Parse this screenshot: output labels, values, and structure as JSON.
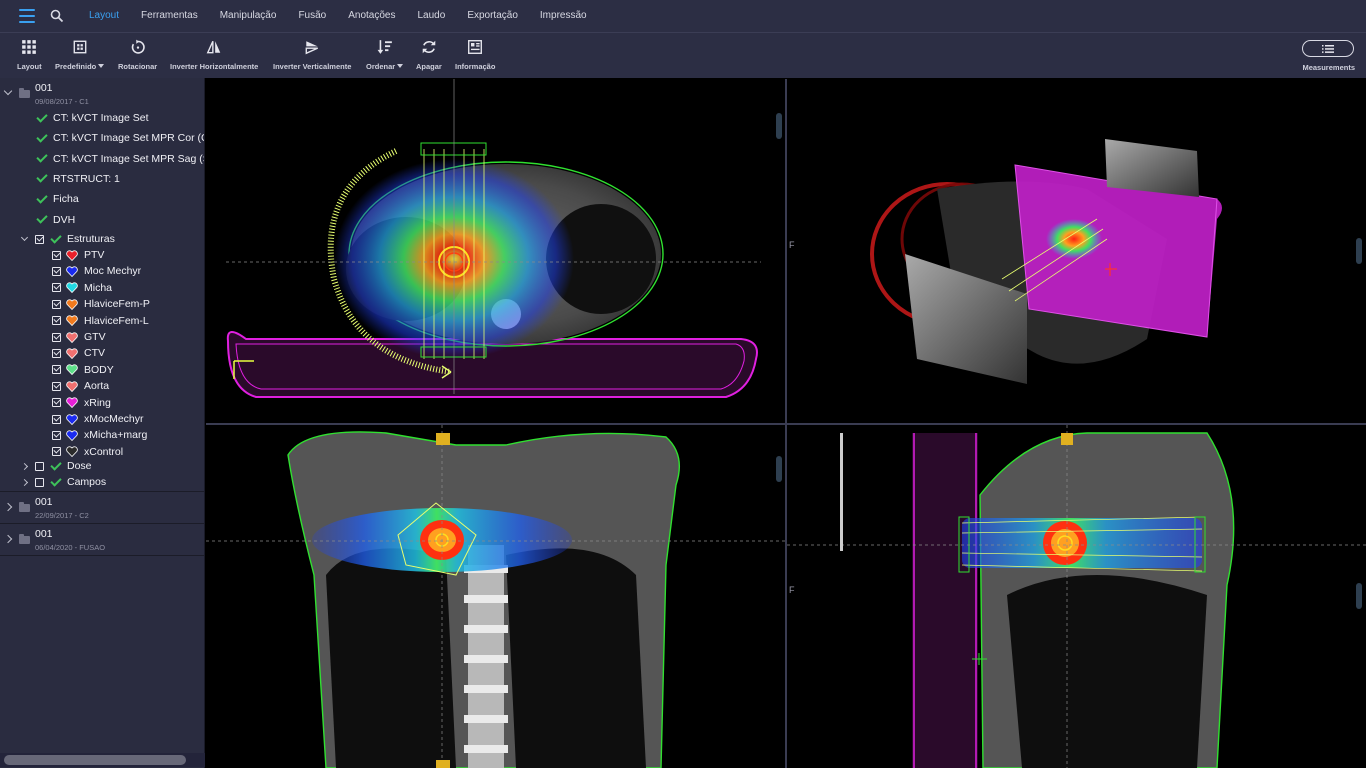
{
  "menu": {
    "items": [
      {
        "label": "Layout",
        "active": true
      },
      {
        "label": "Ferramentas"
      },
      {
        "label": "Manipulação"
      },
      {
        "label": "Fusão"
      },
      {
        "label": "Anotações"
      },
      {
        "label": "Laudo"
      },
      {
        "label": "Exportação"
      },
      {
        "label": "Impressão"
      }
    ],
    "icons": {
      "menu": "hamburger-icon",
      "search": "search-icon"
    },
    "accent_color": "#3aa0f0"
  },
  "toolbar": {
    "layout": "Layout",
    "predefinido": "Predefinido",
    "rotacionar": "Rotacionar",
    "inverter_h": "Inverter Horizontalmente",
    "inverter_v": "Inverter Verticalmente",
    "ordenar": "Ordenar",
    "apagar": "Apagar",
    "informacao": "Informação",
    "measurements": "Measurements"
  },
  "sidebar": {
    "studies": [
      {
        "title": "001",
        "subtitle": "09/08/2017 - C1",
        "expanded": true
      },
      {
        "title": "001",
        "subtitle": "22/09/2017 - C2",
        "expanded": false
      },
      {
        "title": "001",
        "subtitle": "06/04/2020 - FUSAO",
        "expanded": false
      }
    ],
    "series": [
      "CT: kVCT Image Set",
      "CT: kVCT Image Set MPR Cor (Co",
      "CT: kVCT Image Set MPR Sag (Sa",
      "RTSTRUCT: 1",
      "Ficha",
      "DVH"
    ],
    "estruturas_label": "Estruturas",
    "structures": [
      {
        "name": "PTV",
        "color": "#e8202a"
      },
      {
        "name": "Moc Mechyr",
        "color": "#1a2af0"
      },
      {
        "name": "Micha",
        "color": "#22d8e4"
      },
      {
        "name": "HlaviceFem-P",
        "color": "#f07a1e"
      },
      {
        "name": "HlaviceFem-L",
        "color": "#f07a1e"
      },
      {
        "name": "GTV",
        "color": "#f07070"
      },
      {
        "name": "CTV",
        "color": "#f07070"
      },
      {
        "name": "BODY",
        "color": "#5ee08a"
      },
      {
        "name": "Aorta",
        "color": "#f07070"
      },
      {
        "name": "xRing",
        "color": "#e820d8"
      },
      {
        "name": "xMocMechyr",
        "color": "#1a2af0"
      },
      {
        "name": "xMicha+marg",
        "color": "#1a2af0"
      },
      {
        "name": "xControl",
        "color": "#2a2a2a"
      }
    ],
    "dose_label": "Dose",
    "campos_label": "Campos"
  },
  "viewports": {
    "axial": "axial-ct-dose-view",
    "render3d": "3d-volume-render-view",
    "coronal": "coronal-ct-dose-view",
    "sagittal": "sagittal-ct-dose-view",
    "orientation_marker": "F"
  }
}
